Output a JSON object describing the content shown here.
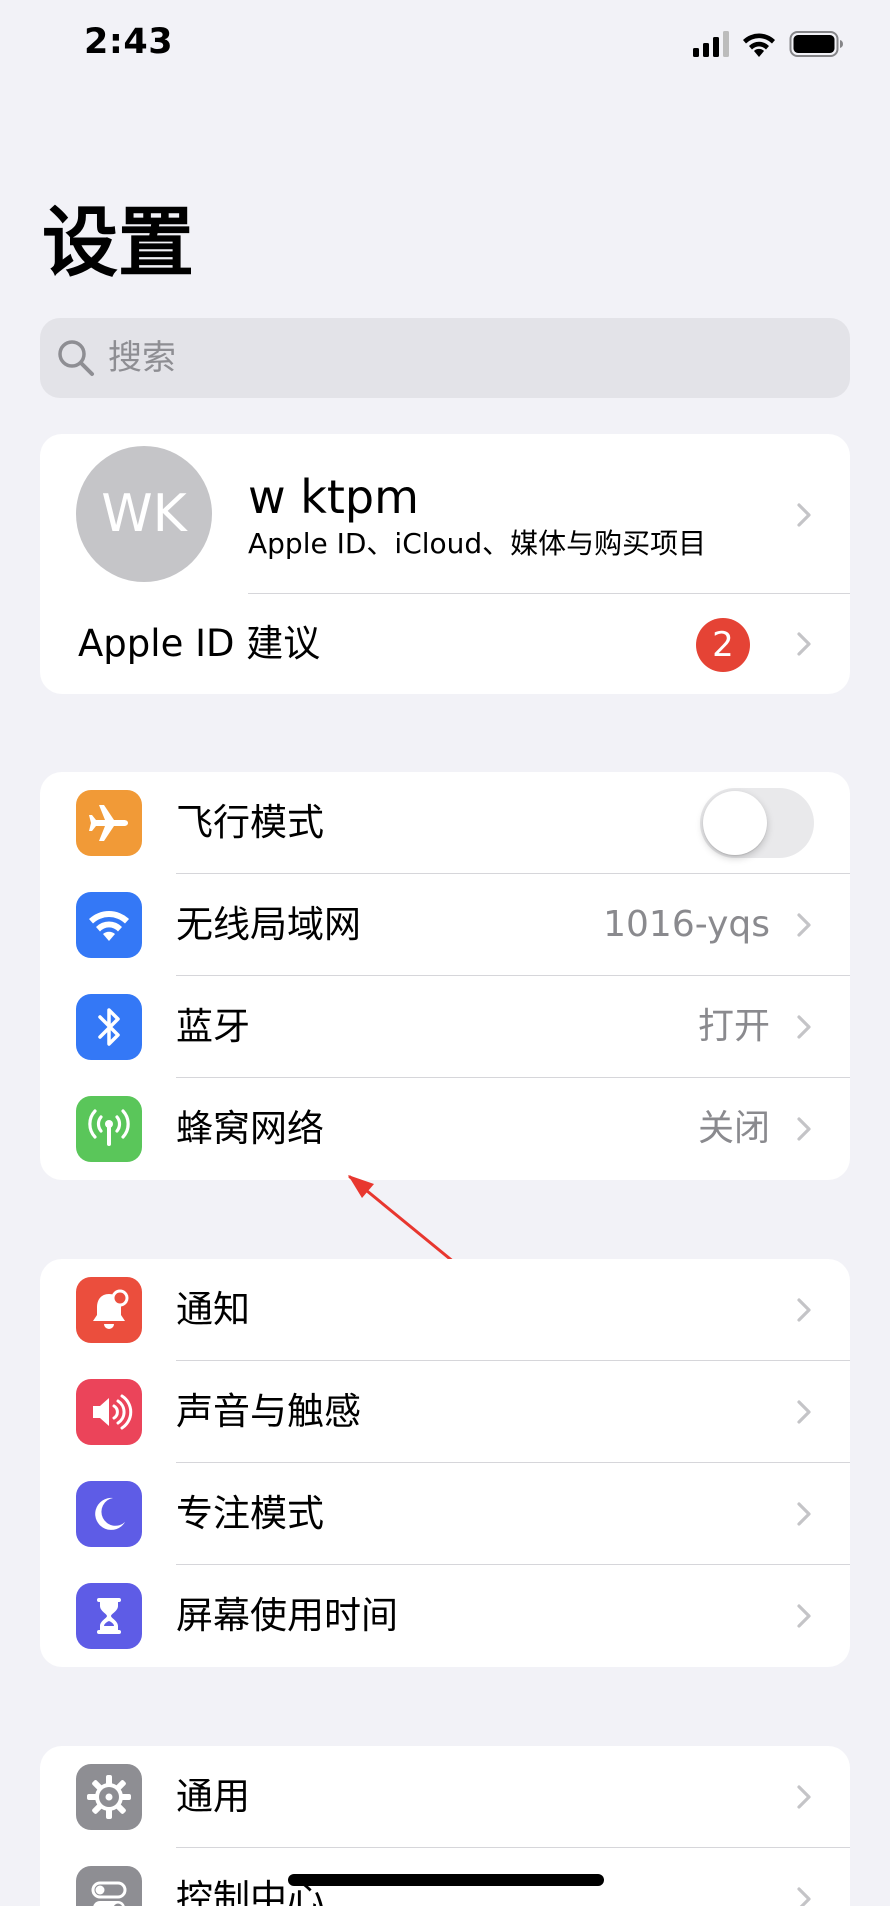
{
  "status_bar": {
    "time": "2:43",
    "signal_icon": "cellular-signal-icon",
    "wifi_icon": "wifi-icon",
    "battery_icon": "battery-icon"
  },
  "header": {
    "title": "设置"
  },
  "search": {
    "placeholder": "搜索",
    "icon": "search-icon"
  },
  "account": {
    "avatar_initials": "WK",
    "name": "w ktpm",
    "subtitle": "Apple ID、iCloud、媒体与购买项目",
    "suggestion_label": "Apple ID 建议",
    "suggestion_badge": "2"
  },
  "connectivity": [
    {
      "label": "飞行模式",
      "icon": "airplane-icon",
      "icon_color": "#f19a37",
      "control": "toggle",
      "toggle_on": false
    },
    {
      "label": "无线局域网",
      "value": "1016-yqs",
      "icon": "wifi-icon",
      "icon_color": "#3478f6"
    },
    {
      "label": "蓝牙",
      "value": "打开",
      "icon": "bluetooth-icon",
      "icon_color": "#3478f6"
    },
    {
      "label": "蜂窝网络",
      "value": "关闭",
      "icon": "cellular-antenna-icon",
      "icon_color": "#5ac65a"
    }
  ],
  "notifications": [
    {
      "label": "通知",
      "icon": "notification-bell-icon",
      "icon_color": "#eb4e3d"
    },
    {
      "label": "声音与触感",
      "icon": "speaker-icon",
      "icon_color": "#eb445a"
    },
    {
      "label": "专注模式",
      "icon": "moon-icon",
      "icon_color": "#5e5ce6"
    },
    {
      "label": "屏幕使用时间",
      "icon": "hourglass-icon",
      "icon_color": "#5e5ce6"
    }
  ],
  "general": [
    {
      "label": "通用",
      "icon": "gear-icon",
      "icon_color": "#8e8e93"
    },
    {
      "label": "控制中心",
      "icon": "control-center-toggles-icon",
      "icon_color": "#8e8e93"
    }
  ],
  "annotation": {
    "arrow_color": "#e8372f",
    "points_to": "蜂窝网络"
  }
}
